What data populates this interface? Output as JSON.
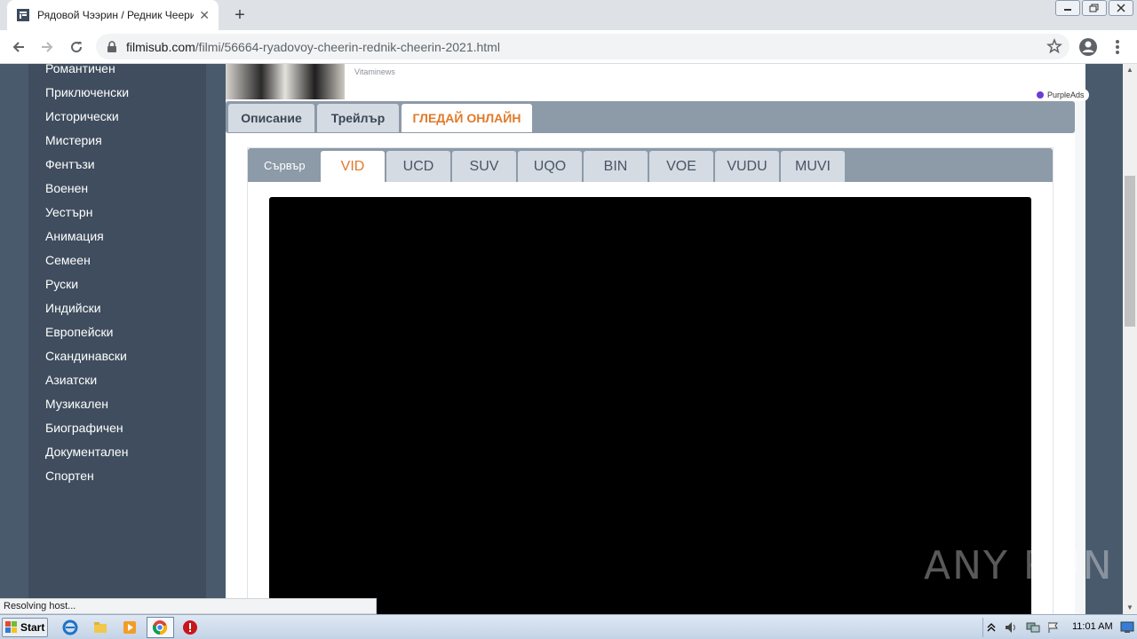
{
  "browser": {
    "tab_title": "Рядовой Чээрин / Редник Чеерин (",
    "url_host": "filmisub.com",
    "url_path": "/filmi/56664-ryadovoy-cheerin-rednik-cheerin-2021.html",
    "status_text": "Resolving host..."
  },
  "sidebar": {
    "genres": [
      "Романтичен",
      "Приключенски",
      "Исторически",
      "Мистерия",
      "Фентъзи",
      "Военен",
      "Уестърн",
      "Анимация",
      "Семеен",
      "Руски",
      "Индийски",
      "Европейски",
      "Скандинавски",
      "Азиатски",
      "Музикален",
      "Биографичен",
      "Документален",
      "Спортен"
    ]
  },
  "ad": {
    "source": "Vitaminews",
    "badge": "PurpleAds"
  },
  "main_tabs": [
    {
      "label": "Описание",
      "active": false
    },
    {
      "label": "Трейлър",
      "active": false
    },
    {
      "label": "ГЛЕДАЙ ОНЛАЙН",
      "active": true
    }
  ],
  "servers": {
    "label": "Сървър",
    "tabs": [
      {
        "label": "VID",
        "active": true
      },
      {
        "label": "UCD",
        "active": false
      },
      {
        "label": "SUV",
        "active": false
      },
      {
        "label": "UQO",
        "active": false
      },
      {
        "label": "BIN",
        "active": false
      },
      {
        "label": "VOE",
        "active": false
      },
      {
        "label": "VUDU",
        "active": false
      },
      {
        "label": "MUVI",
        "active": false
      }
    ]
  },
  "taskbar": {
    "start_label": "Start",
    "clock": "11:01 AM"
  },
  "watermark": "ANY RUN",
  "colors": {
    "accent": "#e07a2a",
    "sidebar": "#3f4d5e",
    "tab_bar": "#8d9aa8"
  }
}
